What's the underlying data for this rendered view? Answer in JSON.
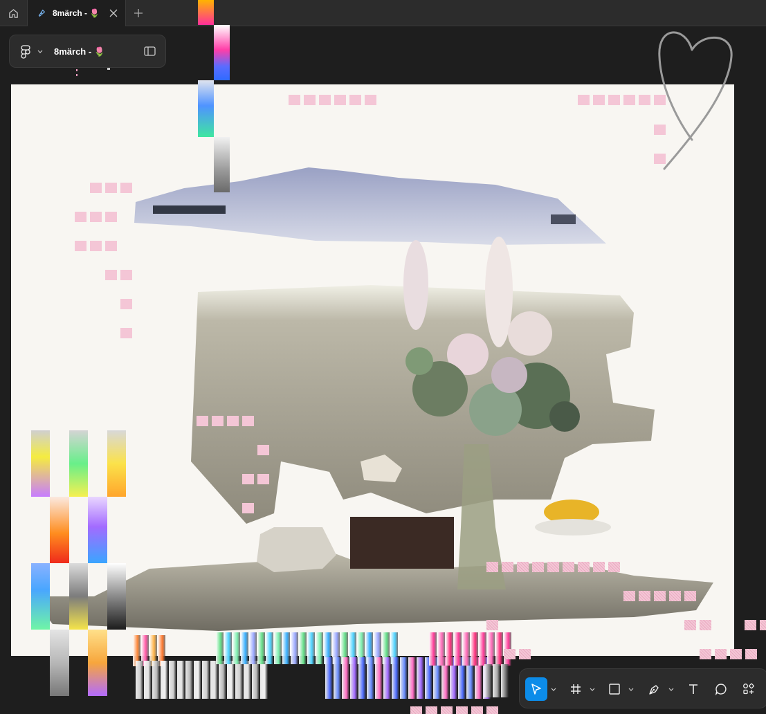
{
  "window": {
    "tab_title": "8märch - ",
    "tab_emoji": "🌷"
  },
  "file_panel": {
    "file_name": "8märch - ",
    "file_emoji": "🌷"
  },
  "icons": {
    "home": "home-icon",
    "file": "figma-file-icon",
    "close": "close-icon",
    "new_tab": "plus-icon",
    "menu": "figma-logo-icon",
    "sidebar": "sidebar-toggle-icon",
    "move": "move-cursor-icon",
    "frame": "frame-hash-icon",
    "shape": "rectangle-icon",
    "pen": "pen-icon",
    "text": "text-icon",
    "comment": "comment-icon",
    "actions": "actions-grid-icon"
  },
  "colors": {
    "accent": "#0c8ce9",
    "panel": "#2c2c2c",
    "canvas": "#1e1e1e",
    "frame": "#f8f6f2",
    "pink": "#f4c6d6"
  }
}
